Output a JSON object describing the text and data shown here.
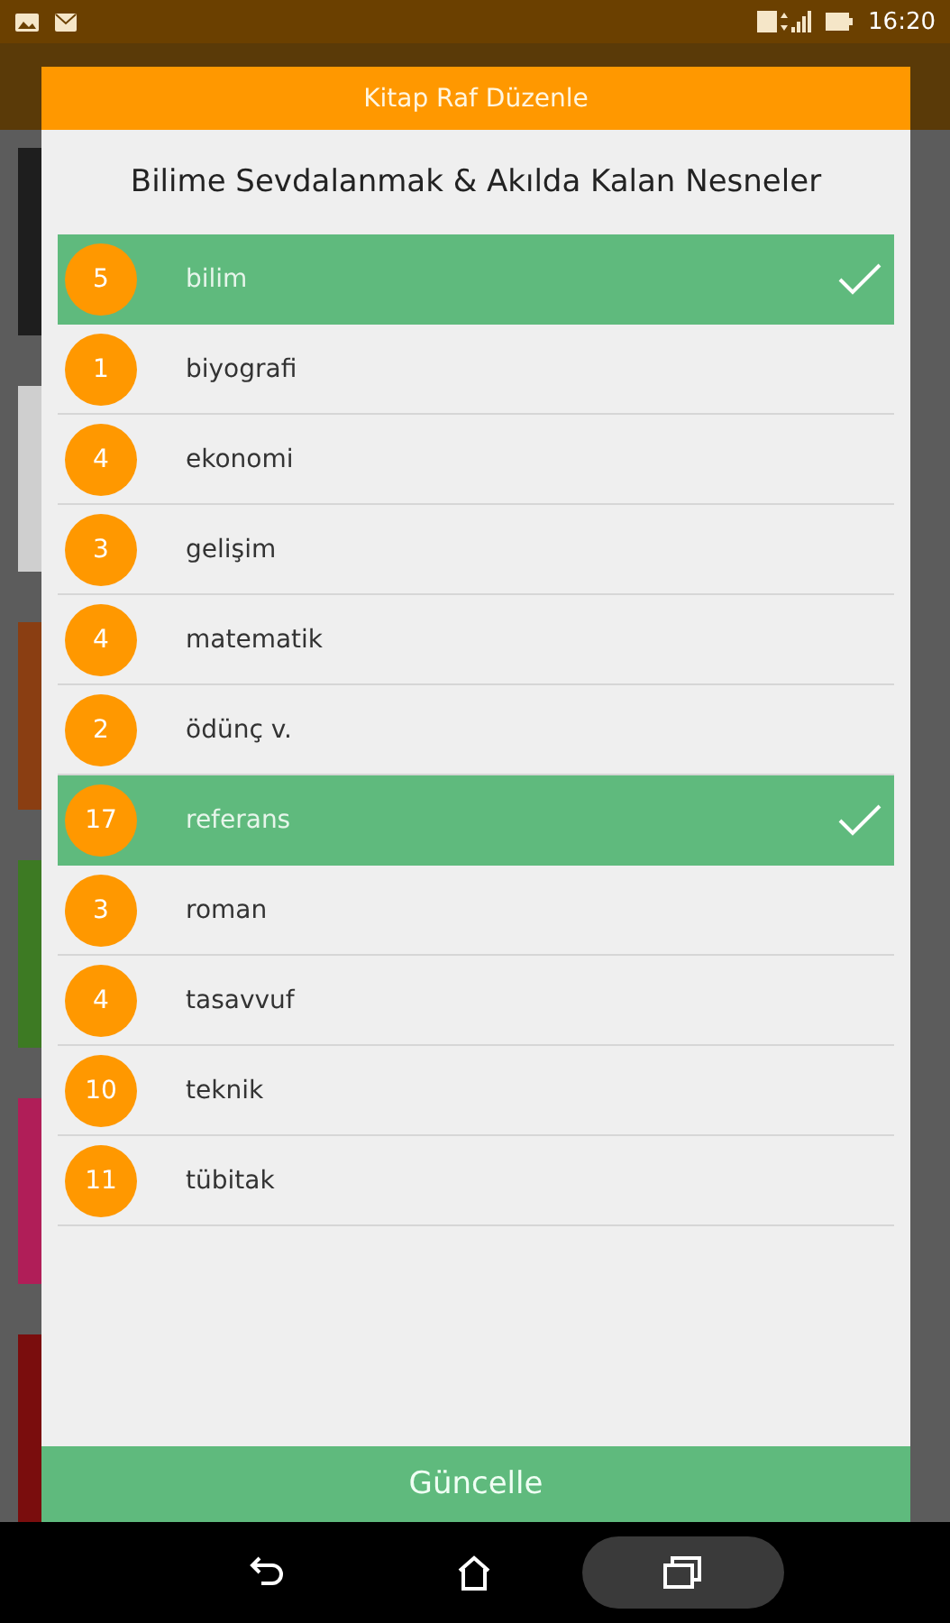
{
  "status_bar": {
    "time": "16:20"
  },
  "dialog": {
    "title": "Kitap Raf Düzenle",
    "subtitle": "Bilime Sevdalanmak & Akılda Kalan Nesneler",
    "shelves": [
      {
        "count": "5",
        "name": "bilim",
        "selected": true
      },
      {
        "count": "1",
        "name": "biyografi",
        "selected": false
      },
      {
        "count": "4",
        "name": "ekonomi",
        "selected": false
      },
      {
        "count": "3",
        "name": "gelişim",
        "selected": false
      },
      {
        "count": "4",
        "name": "matematik",
        "selected": false
      },
      {
        "count": "2",
        "name": "ödünç v.",
        "selected": false
      },
      {
        "count": "17",
        "name": "referans",
        "selected": true
      },
      {
        "count": "3",
        "name": "roman",
        "selected": false
      },
      {
        "count": "4",
        "name": "tasavvuf",
        "selected": false
      },
      {
        "count": "10",
        "name": "teknik",
        "selected": false
      },
      {
        "count": "11",
        "name": "tübitak",
        "selected": false
      }
    ],
    "button": "Güncelle"
  }
}
